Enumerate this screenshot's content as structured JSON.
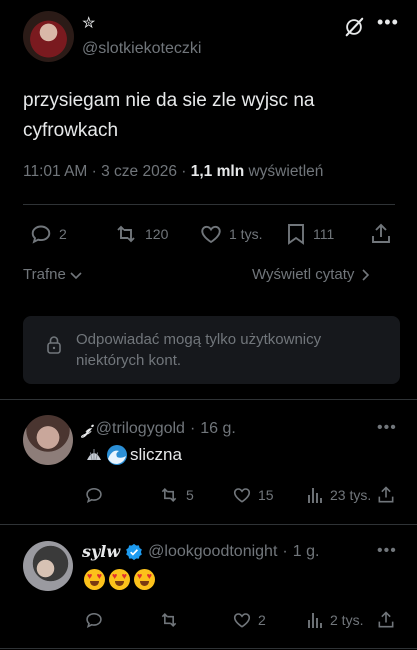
{
  "post": {
    "handle": "@slotkiekoteczki",
    "name_symbol": "✮",
    "text": "przysiegam nie da sie zle wyjsc na cyfrowkach",
    "time": "11:01 AM",
    "date": "3 cze 2026",
    "views_count": "1,1 mln",
    "views_label": "wyświetleń",
    "stats": {
      "replies": "2",
      "reposts": "120",
      "likes": "1 tys.",
      "bookmarks": "111"
    }
  },
  "sort": {
    "label": "Trafne"
  },
  "quotes": {
    "label": "Wyświetl cytaty"
  },
  "restriction": {
    "text": "Odpowiadać mogą tylko użytkownicy niektórych kont."
  },
  "replies": [
    {
      "name": "𝒿",
      "handle": "@trilogygold",
      "time": "16 g.",
      "text": "sliczna",
      "replies": "",
      "reposts": "5",
      "likes": "15",
      "views": "23 tys."
    },
    {
      "name": "sylw",
      "handle": "@lookgoodtonight",
      "time": "1 g.",
      "text": "",
      "replies": "",
      "reposts": "",
      "likes": "2",
      "views": "2 tys.",
      "verified": true
    }
  ],
  "colors": {
    "background": "#000000",
    "text": "#e7e9ea",
    "secondary": "#71767b",
    "divider": "#2f3336",
    "verified": "#1d9bf0"
  },
  "icons": {
    "grok": "grok-icon",
    "more": "more-icon",
    "reply": "reply-icon",
    "repost": "repost-icon",
    "like": "heart-icon",
    "bookmark": "bookmark-icon",
    "share": "share-icon",
    "views": "views-icon",
    "lock": "lock-icon"
  }
}
